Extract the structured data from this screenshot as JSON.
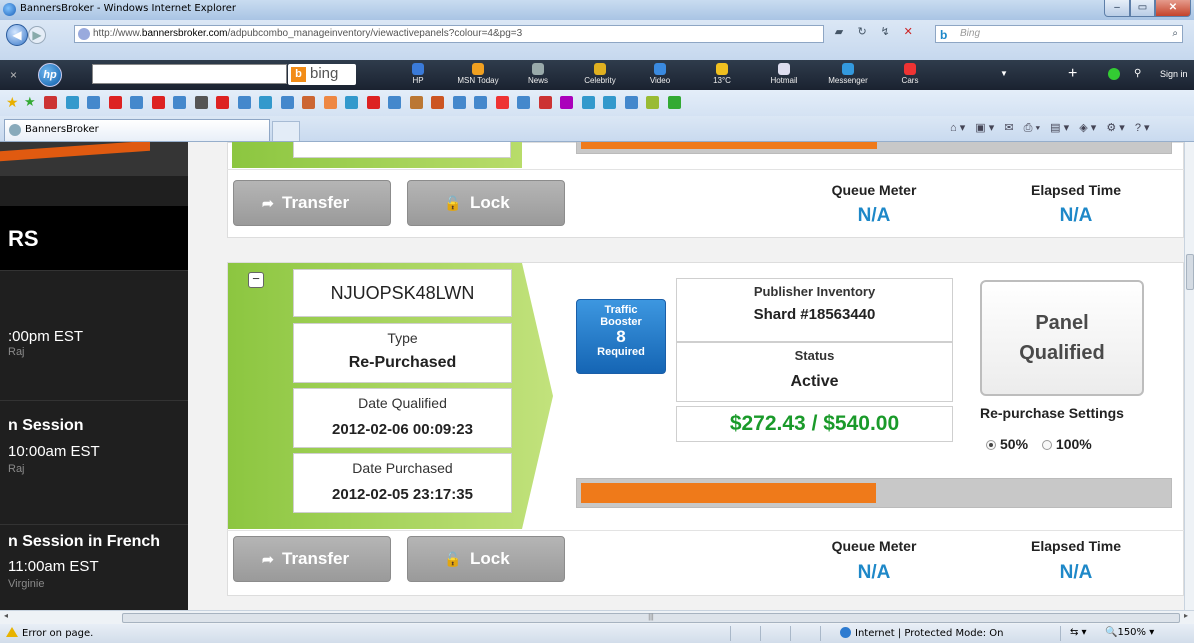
{
  "window": {
    "title": "BannersBroker - Windows Internet Explorer",
    "min": "–",
    "max": "▭",
    "close": "✕"
  },
  "addressbar": {
    "url_prefix": "http://www.",
    "url_domain": "bannersbroker.com",
    "url_path": "/adpubcombo_manageinventory/viewactivepanels?colour=4&pg=3",
    "search_placeholder": "Bing",
    "search_logo": "b"
  },
  "hp_toolbar": {
    "close": "×",
    "logo": "hp",
    "bing_label": "bing",
    "items": [
      {
        "label": "HP",
        "icon": "hp-icon",
        "color": "#3a7ad8"
      },
      {
        "label": "MSN Today",
        "icon": "msn-icon",
        "color": "#f0a020"
      },
      {
        "label": "News",
        "icon": "news-icon",
        "color": "#9aa"
      },
      {
        "label": "Celebrity",
        "icon": "star-icon",
        "color": "#e0b020"
      },
      {
        "label": "Video",
        "icon": "video-icon",
        "color": "#3a8ae0"
      },
      {
        "label": "13°C",
        "icon": "weather-icon",
        "color": "#f0c020"
      },
      {
        "label": "Hotmail",
        "icon": "mail-icon",
        "color": "#dde"
      },
      {
        "label": "Messenger",
        "icon": "messenger-icon",
        "color": "#39d"
      },
      {
        "label": "Cars",
        "icon": "car-icon",
        "color": "#e33"
      }
    ],
    "signin": "Sign in"
  },
  "tab": {
    "label": "BannersBroker"
  },
  "sidebar": {
    "heading": "RS",
    "entries": [
      {
        "time": ":00pm EST",
        "host": "Raj"
      },
      {
        "title": "n Session",
        "time": "10:00am EST",
        "host": "Raj"
      },
      {
        "title": "n Session in French",
        "time": "11:00am EST",
        "host": "Virginie"
      }
    ]
  },
  "top_card": {
    "transfer_label": "Transfer",
    "lock_label": "Lock",
    "queue_meter_label": "Queue Meter",
    "queue_meter_value": "N/A",
    "elapsed_label": "Elapsed Time",
    "elapsed_value": "N/A"
  },
  "panel": {
    "collapse": "−",
    "code": "NJUOPSK48LWN",
    "type_label": "Type",
    "type_value": "Re-Purchased",
    "date_qualified_label": "Date Qualified",
    "date_qualified_value": "2012-02-06 00:09:23",
    "date_purchased_label": "Date Purchased",
    "date_purchased_value": "2012-02-05 23:17:35",
    "traffic_line1": "Traffic",
    "traffic_line2": "Booster",
    "traffic_count": "8",
    "traffic_line3": "Required",
    "inventory_label": "Publisher Inventory",
    "inventory_value": "Shard #18563440",
    "status_label": "Status",
    "status_value": "Active",
    "amount": "$272.43 / $540.00",
    "panel_status_line1": "Panel",
    "panel_status_line2": "Qualified",
    "repurchase_label": "Re-purchase Settings",
    "option_50": "50%",
    "option_100": "100%",
    "progress_fraction": 0.504,
    "transfer_label": "Transfer",
    "lock_label": "Lock",
    "queue_meter_label": "Queue Meter",
    "queue_meter_value": "N/A",
    "elapsed_label": "Elapsed Time",
    "elapsed_value": "N/A"
  },
  "status": {
    "error": "Error on page.",
    "zone": "Internet | Protected Mode: On",
    "zoom": "150%"
  },
  "colors": {
    "accent_blue": "#1e88c8",
    "money_green": "#1a9a2a",
    "progress_orange": "#ef7a1a",
    "panel_green": "#8cc640"
  }
}
